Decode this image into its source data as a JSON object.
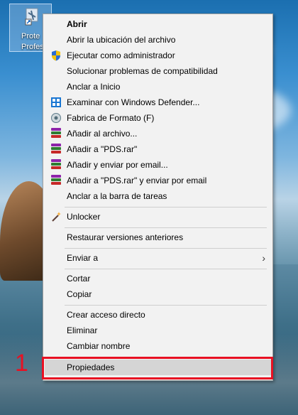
{
  "desktop": {
    "icon_label_line1": "Prote",
    "icon_label_line2": "Profes"
  },
  "menu": {
    "items": [
      {
        "label": "Abrir"
      },
      {
        "label": "Abrir la ubicación del archivo"
      },
      {
        "label": "Ejecutar como administrador"
      },
      {
        "label": "Solucionar problemas de compatibilidad"
      },
      {
        "label": "Anclar a Inicio"
      },
      {
        "label": "Examinar con Windows Defender..."
      },
      {
        "label": "Fabrica de Formato (F)"
      },
      {
        "label": "Añadir al archivo..."
      },
      {
        "label": "Añadir a \"PDS.rar\""
      },
      {
        "label": "Añadir y enviar por email..."
      },
      {
        "label": "Añadir a \"PDS.rar\" y enviar por email"
      },
      {
        "label": "Anclar a la barra de tareas"
      },
      {
        "label": "Unlocker"
      },
      {
        "label": "Restaurar versiones anteriores"
      },
      {
        "label": "Enviar a"
      },
      {
        "label": "Cortar"
      },
      {
        "label": "Copiar"
      },
      {
        "label": "Crear acceso directo"
      },
      {
        "label": "Eliminar"
      },
      {
        "label": "Cambiar nombre"
      },
      {
        "label": "Propiedades"
      }
    ],
    "submenu_arrow": "›"
  },
  "annotation": {
    "marker_text": "1",
    "marker_color": "#e81123"
  }
}
